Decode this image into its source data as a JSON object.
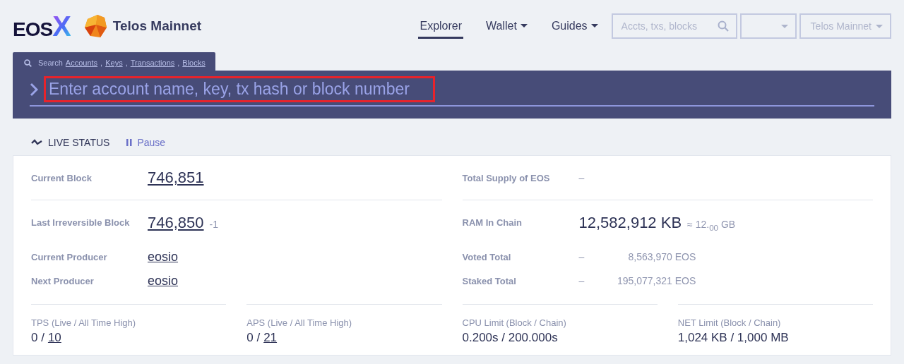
{
  "header": {
    "logo": {
      "text": "EOS",
      "mark": "X"
    },
    "network_name": "Telos Mainnet",
    "nav": [
      {
        "label": "Explorer",
        "selected": true,
        "dropdown": false
      },
      {
        "label": "Wallet",
        "selected": false,
        "dropdown": true
      },
      {
        "label": "Guides",
        "selected": false,
        "dropdown": true
      }
    ],
    "search": {
      "placeholder": "Accts, txs, blocks"
    },
    "network_select": {
      "value": "Telos Mainnet"
    }
  },
  "search_panel": {
    "tab": {
      "prefix": "Search",
      "links": [
        {
          "text": "Accounts",
          "suffix": ","
        },
        {
          "text": "Keys",
          "suffix": ","
        },
        {
          "text": "Transactions",
          "suffix": ","
        },
        {
          "text": "Blocks"
        }
      ]
    },
    "input": {
      "placeholder": "Enter account name, key, tx hash or block number",
      "highlighted": true
    }
  },
  "live_status": {
    "title": "LIVE STATUS",
    "pause": "Pause"
  },
  "stats_left": [
    {
      "kind": "big_link",
      "label": "Current Block",
      "value": "746,851",
      "divider_after": true
    },
    {
      "kind": "big_link",
      "label": "Last Irreversible Block",
      "value": "746,850",
      "note": "-1"
    },
    {
      "kind": "link",
      "label": "Current Producer",
      "value": "eosio"
    },
    {
      "kind": "link",
      "label": "Next Producer",
      "value": "eosio"
    }
  ],
  "stats_right": [
    {
      "kind": "dash",
      "label": "Total Supply of EOS",
      "value": "–",
      "divider_after": true
    },
    {
      "kind": "big",
      "label": "RAM In Chain",
      "value": "12,582,912 KB",
      "note": "≈ 12.$_{00}$ GB"
    },
    {
      "kind": "pair",
      "label": "Voted Total",
      "value": "–",
      "amount": "8,563,970 EOS"
    },
    {
      "kind": "pair",
      "label": "Staked Total",
      "value": "–",
      "amount": "195,077,321 EOS"
    }
  ],
  "metrics": [
    {
      "kind": "ratio_link",
      "label": "TPS (Live / All Time High)",
      "value": "0 /",
      "link": "10"
    },
    {
      "kind": "ratio_link",
      "label": "APS (Live / All Time High)",
      "value": "0 /",
      "link": "21"
    },
    {
      "kind": "plain",
      "label": "CPU Limit (Block / Chain)",
      "value": "0.200s / 200.000s"
    },
    {
      "kind": "plain",
      "label": "NET Limit (Block / Chain)",
      "value": "1,024 KB / 1,000 MB"
    }
  ]
}
